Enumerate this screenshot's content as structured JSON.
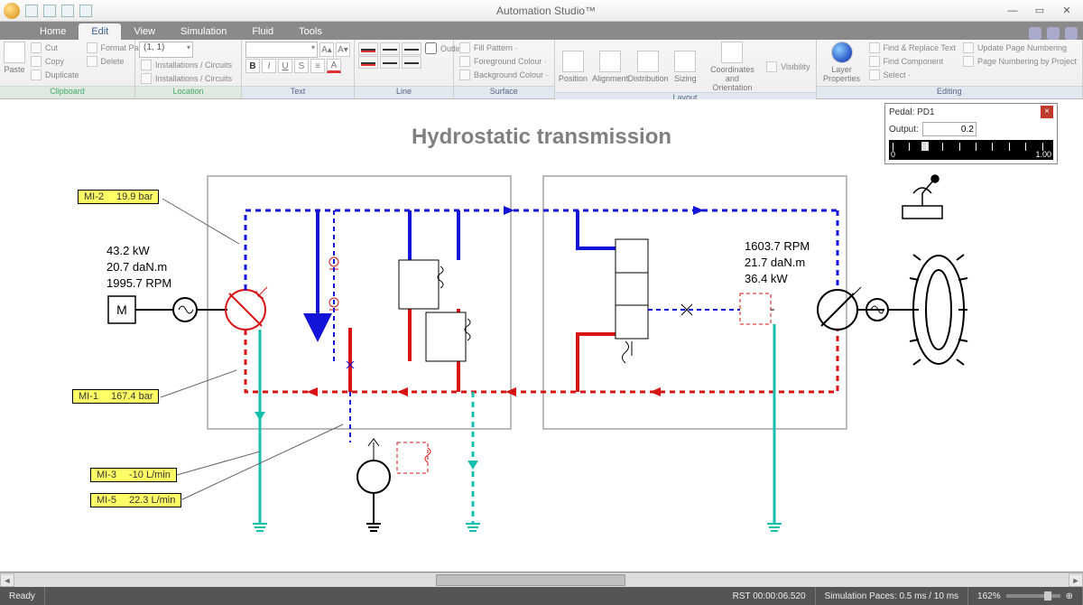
{
  "app_title": "Automation Studio™",
  "menu": {
    "tabs": [
      "Home",
      "Edit",
      "View",
      "Simulation",
      "Fluid",
      "Tools"
    ],
    "active_index": 1
  },
  "ribbon": {
    "clipboard": {
      "paste": "Paste",
      "cut": "Cut",
      "copy": "Copy",
      "delete": "Delete",
      "duplicate": "Duplicate",
      "format_painter": "Format Painter",
      "label": "Clipboard"
    },
    "location": {
      "coord": "(1, 1)",
      "inst1": "Installations / Circuits",
      "inst2": "Installations / Circuits",
      "label": "Location"
    },
    "text": {
      "bold": "B",
      "ital": "I",
      "under": "U",
      "strike": "S",
      "sizeUp": "A▴",
      "sizeDn": "A▾",
      "label": "Text"
    },
    "line": {
      "outline": "Outline",
      "label": "Line"
    },
    "surface": {
      "fill": "Fill Pattern ·",
      "fg": "Foreground Colour ·",
      "bg": "Background Colour ·",
      "label": "Surface"
    },
    "layout": {
      "position": "Position",
      "alignment": "Alignment",
      "distribution": "Distribution",
      "sizing": "Sizing",
      "coords": "Coordinates and Orientation",
      "visibility": "Visibility",
      "label": "Layout"
    },
    "editing": {
      "layer": "Layer Properties",
      "find": "Find & Replace Text",
      "comp": "Find Component",
      "select": "Select ·",
      "upd": "Update Page Numbering",
      "byproj": "Page Numbering by Project",
      "label": "Editing"
    }
  },
  "page_title": "Hydrostatic transmission",
  "pedal": {
    "title": "Pedal: PD1",
    "output_label": "Output:",
    "value": "0.2",
    "min": "0",
    "max": "1.00"
  },
  "flags": {
    "mi2": {
      "id": "MI-2",
      "val": "19.9 bar"
    },
    "mi1": {
      "id": "MI-1",
      "val": "167.4 bar"
    },
    "mi3": {
      "id": "MI-3",
      "val": "-10 L/min"
    },
    "mi5": {
      "id": "MI-5",
      "val": "22.3 L/min"
    }
  },
  "readout_left": {
    "l1": "43.2 kW",
    "l2": "20.7 daN.m",
    "l3": "1995.7 RPM"
  },
  "readout_right": {
    "l1": "1603.7 RPM",
    "l2": "21.7 daN.m",
    "l3": "36.4 kW"
  },
  "status": {
    "ready": "Ready",
    "rst": "RST 00:00:06.520",
    "paces": "Simulation Paces: 0.5 ms / 10 ms",
    "zoom": "162%"
  }
}
